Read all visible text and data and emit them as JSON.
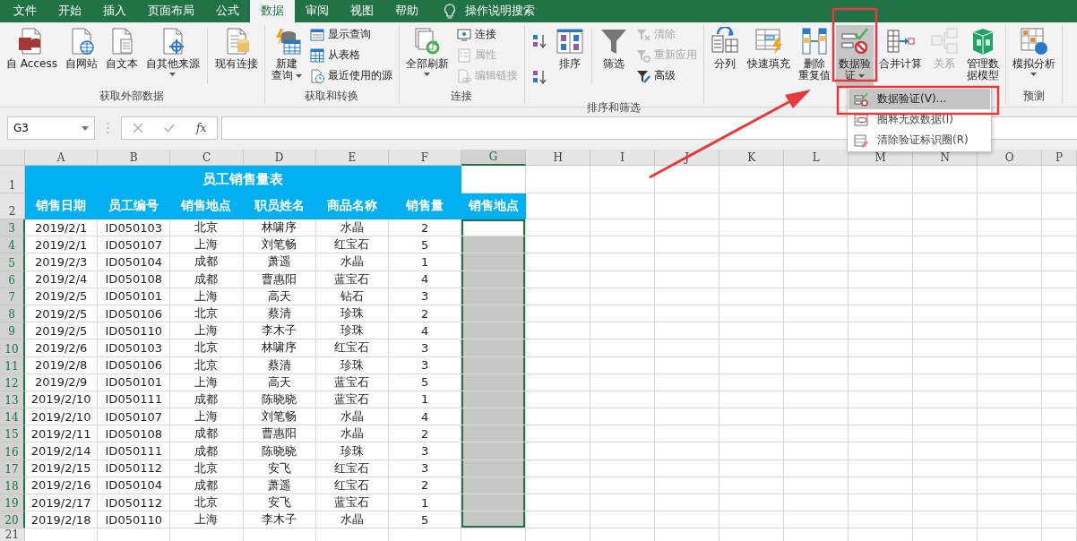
{
  "tabs": [
    {
      "label": "文件",
      "selected": false
    },
    {
      "label": "开始",
      "selected": false
    },
    {
      "label": "插入",
      "selected": false
    },
    {
      "label": "页面布局",
      "selected": false
    },
    {
      "label": "公式",
      "selected": false
    },
    {
      "label": "数据",
      "selected": true
    },
    {
      "label": "审阅",
      "selected": false
    },
    {
      "label": "视图",
      "selected": false
    },
    {
      "label": "帮助",
      "selected": false
    }
  ],
  "tell_me": "操作说明搜索",
  "ribbon": [
    {
      "label": "获取外部数据",
      "items": [
        {
          "kind": "large",
          "lines": [
            "自 Access"
          ],
          "dropdown": false,
          "disabled": false,
          "pressed": false
        },
        {
          "kind": "large",
          "lines": [
            "自网站"
          ],
          "dropdown": false,
          "disabled": false,
          "pressed": false
        },
        {
          "kind": "large",
          "lines": [
            "自文本"
          ],
          "dropdown": false,
          "disabled": false,
          "pressed": false
        },
        {
          "kind": "large",
          "lines": [
            "自其他来源"
          ],
          "dropdown": true,
          "disabled": false,
          "pressed": false
        },
        {
          "kind": "separator"
        },
        {
          "kind": "large",
          "lines": [
            "现有连接"
          ],
          "dropdown": false,
          "disabled": false,
          "pressed": false
        }
      ]
    },
    {
      "label": "获取和转换",
      "items": [
        {
          "kind": "large",
          "lines": [
            "新建",
            "查询"
          ],
          "dropdown": true,
          "disabled": false,
          "pressed": false
        },
        {
          "kind": "stack",
          "items": [
            {
              "label": "显示查询",
              "disabled": false
            },
            {
              "label": "从表格",
              "disabled": false
            },
            {
              "label": "最近使用的源",
              "disabled": false
            }
          ]
        }
      ]
    },
    {
      "label": "连接",
      "items": [
        {
          "kind": "large",
          "lines": [
            "全部刷新"
          ],
          "dropdown": true,
          "disabled": false,
          "pressed": false
        },
        {
          "kind": "stack",
          "items": [
            {
              "label": "连接",
              "disabled": false
            },
            {
              "label": "属性",
              "disabled": true
            },
            {
              "label": "编辑链接",
              "disabled": true
            }
          ]
        }
      ]
    },
    {
      "label": "排序和筛选",
      "items": [
        {
          "kind": "sort_buttons"
        },
        {
          "kind": "large",
          "lines": [
            "排序"
          ],
          "dropdown": false,
          "disabled": false,
          "pressed": false
        },
        {
          "kind": "separator"
        },
        {
          "kind": "large",
          "lines": [
            "筛选"
          ],
          "dropdown": false,
          "disabled": false,
          "pressed": false
        },
        {
          "kind": "stack",
          "items": [
            {
              "label": "清除",
              "disabled": true
            },
            {
              "label": "重新应用",
              "disabled": true
            },
            {
              "label": "高级",
              "disabled": false
            }
          ]
        }
      ]
    },
    {
      "items": [
        {
          "kind": "large",
          "lines": [
            "分列"
          ],
          "dropdown": false,
          "disabled": false,
          "pressed": false
        },
        {
          "kind": "large",
          "lines": [
            "快速填充"
          ],
          "dropdown": false,
          "disabled": false,
          "pressed": false
        },
        {
          "kind": "large",
          "lines": [
            "删除",
            "重复值"
          ],
          "dropdown": false,
          "disabled": false,
          "pressed": false
        },
        {
          "kind": "large",
          "lines": [
            "数据验",
            "证"
          ],
          "dropdown": true,
          "disabled": false,
          "pressed": true
        },
        {
          "kind": "large",
          "lines": [
            "合并计算"
          ],
          "dropdown": false,
          "disabled": false,
          "pressed": false
        },
        {
          "kind": "large",
          "lines": [
            "关系"
          ],
          "dropdown": false,
          "disabled": true,
          "pressed": false
        },
        {
          "kind": "large",
          "lines": [
            "管理数",
            "据模型"
          ],
          "dropdown": false,
          "disabled": false,
          "pressed": false
        }
      ]
    },
    {
      "label": "预测",
      "items": [
        {
          "kind": "large",
          "lines": [
            "模拟分析"
          ],
          "dropdown": true,
          "disabled": false,
          "pressed": false
        }
      ]
    }
  ],
  "validation_menu": [
    {
      "label": "数据验证(V)...",
      "selected": true
    },
    {
      "label": "圈释无效数据(I)",
      "selected": false
    },
    {
      "label": "清除验证标识圈(R)",
      "selected": false
    }
  ],
  "formula_bar": {
    "name_box": "G3",
    "fx": "fx"
  },
  "sheet": {
    "columns": [
      {
        "label": "A",
        "selected": false
      },
      {
        "label": "B",
        "selected": false
      },
      {
        "label": "C",
        "selected": false
      },
      {
        "label": "D",
        "selected": false
      },
      {
        "label": "E",
        "selected": false
      },
      {
        "label": "F",
        "selected": false
      },
      {
        "label": "G",
        "selected": true
      },
      {
        "label": "H",
        "selected": false
      },
      {
        "label": "I",
        "selected": false
      },
      {
        "label": "J",
        "selected": false
      },
      {
        "label": "K",
        "selected": false
      },
      {
        "label": "L",
        "selected": false
      },
      {
        "label": "M",
        "selected": false
      },
      {
        "label": "N",
        "selected": false
      },
      {
        "label": "O",
        "selected": false
      },
      {
        "label": "P",
        "selected": false
      }
    ],
    "title_row": {
      "number": "1",
      "title": "员工销售量表"
    },
    "header_row": {
      "number": "2",
      "headers": [
        "销售日期",
        "员工编号",
        "销售地点",
        "职员姓名",
        "商品名称",
        "销售量",
        "销售地点"
      ]
    },
    "rows": [
      {
        "number": "3",
        "selected": true,
        "active": true,
        "cells": [
          "2019/2/1",
          "ID050103",
          "北京",
          "林啸序",
          "水晶",
          "2"
        ]
      },
      {
        "number": "4",
        "selected": true,
        "active": false,
        "cells": [
          "2019/2/1",
          "ID050107",
          "上海",
          "刘笔畅",
          "红宝石",
          "5"
        ]
      },
      {
        "number": "5",
        "selected": true,
        "active": false,
        "cells": [
          "2019/2/3",
          "ID050104",
          "成都",
          "萧遥",
          "水晶",
          "1"
        ]
      },
      {
        "number": "6",
        "selected": true,
        "active": false,
        "cells": [
          "2019/2/4",
          "ID050108",
          "成都",
          "曹惠阳",
          "蓝宝石",
          "4"
        ]
      },
      {
        "number": "7",
        "selected": true,
        "active": false,
        "cells": [
          "2019/2/5",
          "ID050101",
          "上海",
          "高天",
          "钻石",
          "3"
        ]
      },
      {
        "number": "8",
        "selected": true,
        "active": false,
        "cells": [
          "2019/2/5",
          "ID050106",
          "北京",
          "蔡清",
          "珍珠",
          "2"
        ]
      },
      {
        "number": "9",
        "selected": true,
        "active": false,
        "cells": [
          "2019/2/5",
          "ID050110",
          "上海",
          "李木子",
          "珍珠",
          "4"
        ]
      },
      {
        "number": "10",
        "selected": true,
        "active": false,
        "cells": [
          "2019/2/6",
          "ID050103",
          "北京",
          "林啸序",
          "红宝石",
          "3"
        ]
      },
      {
        "number": "11",
        "selected": true,
        "active": false,
        "cells": [
          "2019/2/8",
          "ID050106",
          "北京",
          "蔡清",
          "珍珠",
          "3"
        ]
      },
      {
        "number": "12",
        "selected": true,
        "active": false,
        "cells": [
          "2019/2/9",
          "ID050101",
          "上海",
          "高天",
          "蓝宝石",
          "5"
        ]
      },
      {
        "number": "13",
        "selected": true,
        "active": false,
        "cells": [
          "2019/2/10",
          "ID050111",
          "成都",
          "陈晓晓",
          "蓝宝石",
          "1"
        ]
      },
      {
        "number": "14",
        "selected": true,
        "active": false,
        "cells": [
          "2019/2/10",
          "ID050107",
          "上海",
          "刘笔畅",
          "水晶",
          "4"
        ]
      },
      {
        "number": "15",
        "selected": true,
        "active": false,
        "cells": [
          "2019/2/11",
          "ID050108",
          "成都",
          "曹惠阳",
          "水晶",
          "2"
        ]
      },
      {
        "number": "16",
        "selected": true,
        "active": false,
        "cells": [
          "2019/2/14",
          "ID050111",
          "成都",
          "陈晓晓",
          "珍珠",
          "3"
        ]
      },
      {
        "number": "17",
        "selected": true,
        "active": false,
        "cells": [
          "2019/2/15",
          "ID050112",
          "北京",
          "安飞",
          "红宝石",
          "3"
        ]
      },
      {
        "number": "18",
        "selected": true,
        "active": false,
        "cells": [
          "2019/2/16",
          "ID050104",
          "成都",
          "萧遥",
          "红宝石",
          "2"
        ]
      },
      {
        "number": "19",
        "selected": true,
        "active": false,
        "cells": [
          "2019/2/17",
          "ID050112",
          "北京",
          "安飞",
          "蓝宝石",
          "1"
        ]
      },
      {
        "number": "20",
        "selected": true,
        "active": false,
        "cells": [
          "2019/2/18",
          "ID050110",
          "上海",
          "李木子",
          "水晶",
          "5"
        ]
      }
    ],
    "blank_rows": [
      {
        "number": "21",
        "selected": false
      }
    ]
  }
}
